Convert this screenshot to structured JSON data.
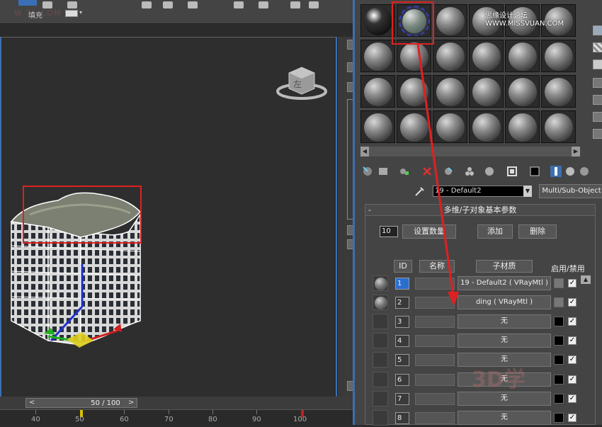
{
  "top_toolbar": {
    "fill_label": "填充",
    "watermark": "W 3J .COM"
  },
  "timeline": {
    "frame_counter": "50 / 100",
    "prev": "<",
    "next": ">",
    "ticks": [
      "40",
      "50",
      "60",
      "70",
      "80",
      "90",
      "100"
    ]
  },
  "viewcube": {
    "label": "左"
  },
  "watermark_top": "思缘设计论坛 WWW.MISSVUAN.COM",
  "material_editor": {
    "material_name": "19 - Default2",
    "material_type": "Multi/Sub-Object",
    "rollout_title": "多维/子对象基本参数",
    "rollout_toggle": "-",
    "count_value": "10",
    "set_count_button": "设置数量",
    "add_button": "添加",
    "delete_button": "删除",
    "headers": {
      "id": "ID",
      "name": "名称",
      "submaterial": "子材质",
      "toggle": "启用/禁用"
    },
    "rows": [
      {
        "id": "1",
        "material": "19 - Default2 ( VRayMtl )",
        "swatch": "#777777",
        "has_thumb": true
      },
      {
        "id": "2",
        "material": "ding ( VRayMtl )",
        "swatch": "#777777",
        "has_thumb": true
      },
      {
        "id": "3",
        "material": "无",
        "swatch": "#000000",
        "has_thumb": false
      },
      {
        "id": "4",
        "material": "无",
        "swatch": "#000000",
        "has_thumb": false
      },
      {
        "id": "5",
        "material": "无",
        "swatch": "#000000",
        "has_thumb": false
      },
      {
        "id": "6",
        "material": "无",
        "swatch": "#000000",
        "has_thumb": false
      },
      {
        "id": "7",
        "material": "无",
        "swatch": "#000000",
        "has_thumb": false
      },
      {
        "id": "8",
        "material": "无",
        "swatch": "#000000",
        "has_thumb": false
      }
    ],
    "check_mark": "✓",
    "watermark_bottom": "3D学"
  },
  "colors": {
    "accent_blue": "#3c6fb0",
    "annotation_red": "#e02020"
  }
}
